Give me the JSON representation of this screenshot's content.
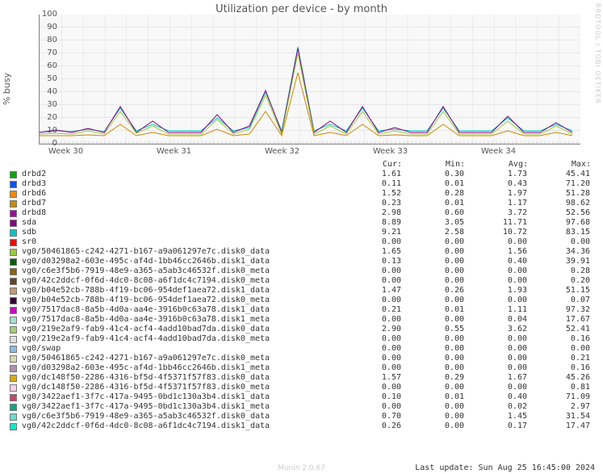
{
  "watermark": "RRDTOOL / TOBI OETIKER",
  "tool": "Munin 2.0.67",
  "last_update": "Last update: Sun Aug 25 16:45:00 2024",
  "chart_data": {
    "type": "line",
    "title": "Utilization per device - by month",
    "ylabel": "% busy",
    "ylim": [
      0,
      100
    ],
    "yticks": [
      0,
      10,
      20,
      30,
      40,
      50,
      60,
      70,
      80,
      90,
      100
    ],
    "categories": [
      "Week 30",
      "Week 31",
      "Week 32",
      "Week 33",
      "Week 34"
    ],
    "columns": [
      "Cur:",
      "Min:",
      "Avg:",
      "Max:"
    ],
    "series": [
      {
        "name": "drbd2",
        "color": "#00aa00",
        "cur": "1.61",
        "min": "0.30",
        "avg": "1.73",
        "max": "45.41"
      },
      {
        "name": "drbd3",
        "color": "#0055ff",
        "cur": "0.11",
        "min": "0.01",
        "avg": "0.43",
        "max": "71.20"
      },
      {
        "name": "drbd6",
        "color": "#ff8800",
        "cur": "1.52",
        "min": "0.28",
        "avg": "1.97",
        "max": "51.28"
      },
      {
        "name": "drbd7",
        "color": "#cc8800",
        "cur": "0.23",
        "min": "0.01",
        "avg": "1.17",
        "max": "98.62"
      },
      {
        "name": "drbd8",
        "color": "#aa00aa",
        "cur": "2.98",
        "min": "0.60",
        "avg": "3.72",
        "max": "52.56"
      },
      {
        "name": "sda",
        "color": "#880088",
        "cur": "8.89",
        "min": "3.05",
        "avg": "11.71",
        "max": "97.68"
      },
      {
        "name": "sdb",
        "color": "#00c8c8",
        "cur": "9.21",
        "min": "2.58",
        "avg": "10.72",
        "max": "83.15"
      },
      {
        "name": "sr0",
        "color": "#ff0000",
        "cur": "0.00",
        "min": "0.00",
        "avg": "0.00",
        "max": "0.00"
      },
      {
        "name": "vg0/50461865-c242-4271-b167-a9a061297e7c.disk0_data",
        "color": "#9acd32",
        "cur": "1.65",
        "min": "0.00",
        "avg": "1.56",
        "max": "34.36"
      },
      {
        "name": "vg0/d03298a2-603e-495c-af4d-1bb46cc2646b.disk1_data",
        "color": "#006400",
        "cur": "0.13",
        "min": "0.00",
        "avg": "0.40",
        "max": "39.91"
      },
      {
        "name": "vg0/c6e3f5b6-7919-48e9-a365-a5ab3c46532f.disk0_meta",
        "color": "#8b6508",
        "cur": "0.00",
        "min": "0.00",
        "avg": "0.00",
        "max": "0.28"
      },
      {
        "name": "vg0/42c2ddcf-0f6d-4dc0-8c08-a6f1dc4c7194.disk0_meta",
        "color": "#6b4226",
        "cur": "0.00",
        "min": "0.00",
        "avg": "0.00",
        "max": "0.20"
      },
      {
        "name": "vg0/b04e52cb-788b-4f19-bc06-954def1aea72.disk1_data",
        "color": "#c19a6b",
        "cur": "1.47",
        "min": "0.26",
        "avg": "1.93",
        "max": "51.15"
      },
      {
        "name": "vg0/b04e52cb-788b-4f19-bc06-954def1aea72.disk0_meta",
        "color": "#330033",
        "cur": "0.00",
        "min": "0.00",
        "avg": "0.00",
        "max": "0.07"
      },
      {
        "name": "vg0/7517dac8-8a5b-4d0a-aa4e-3916b0c63a78.disk1_data",
        "color": "#cc00cc",
        "cur": "0.21",
        "min": "0.01",
        "avg": "1.11",
        "max": "97.32"
      },
      {
        "name": "vg0/7517dac8-8a5b-4d0a-aa4e-3916b0c63a78.disk1_meta",
        "color": "#a0e0d0",
        "cur": "0.00",
        "min": "0.00",
        "avg": "0.04",
        "max": "17.67"
      },
      {
        "name": "vg0/219e2af9-fab9-41c4-acf4-4add10bad7da.disk0_data",
        "color": "#a0d070",
        "cur": "2.90",
        "min": "0.55",
        "avg": "3.62",
        "max": "52.41"
      },
      {
        "name": "vg0/219e2af9-fab9-41c4-acf4-4add10bad7da.disk0_meta",
        "color": "#e0e0e0",
        "cur": "0.00",
        "min": "0.00",
        "avg": "0.00",
        "max": "0.16"
      },
      {
        "name": "vg0/swap",
        "color": "#88bbee",
        "cur": "0.00",
        "min": "0.00",
        "avg": "0.00",
        "max": "0.00"
      },
      {
        "name": "vg0/50461865-c242-4271-b167-a9a061297e7c.disk0_meta",
        "color": "#d8d8a8",
        "cur": "0.00",
        "min": "0.00",
        "avg": "0.00",
        "max": "0.21"
      },
      {
        "name": "vg0/d03298a2-603e-495c-af4d-1bb46cc2646b.disk1_meta",
        "color": "#b090b0",
        "cur": "0.00",
        "min": "0.00",
        "avg": "0.00",
        "max": "0.16"
      },
      {
        "name": "vg0/dc148f50-2286-4316-bf5d-4f5371f57f83.disk0_data",
        "color": "#ddaa00",
        "cur": "1.57",
        "min": "0.29",
        "avg": "1.67",
        "max": "45.26"
      },
      {
        "name": "vg0/dc148f50-2286-4316-bf5d-4f5371f57f83.disk0_meta",
        "color": "#ffccee",
        "cur": "0.00",
        "min": "0.00",
        "avg": "0.00",
        "max": "0.81"
      },
      {
        "name": "vg0/3422aef1-3f7c-417a-9495-0bd1c130a3b4.disk1_data",
        "color": "#cc4466",
        "cur": "0.10",
        "min": "0.01",
        "avg": "0.40",
        "max": "71.09"
      },
      {
        "name": "vg0/3422aef1-3f7c-417a-9495-0bd1c130a3b4.disk1_meta",
        "color": "#00aa88",
        "cur": "0.00",
        "min": "0.00",
        "avg": "0.02",
        "max": "2.97"
      },
      {
        "name": "vg0/c6e3f5b6-7919-48e9-a365-a5ab3c46532f.disk0_data",
        "color": "#66ddcc",
        "cur": "0.70",
        "min": "0.00",
        "avg": "1.45",
        "max": "31.54"
      },
      {
        "name": "vg0/42c2ddcf-0f6d-4dc0-8c08-a6f1dc4c7194.disk1_data",
        "color": "#00eecc",
        "cur": "0.26",
        "min": "0.00",
        "avg": "0.17",
        "max": "17.47"
      }
    ]
  }
}
